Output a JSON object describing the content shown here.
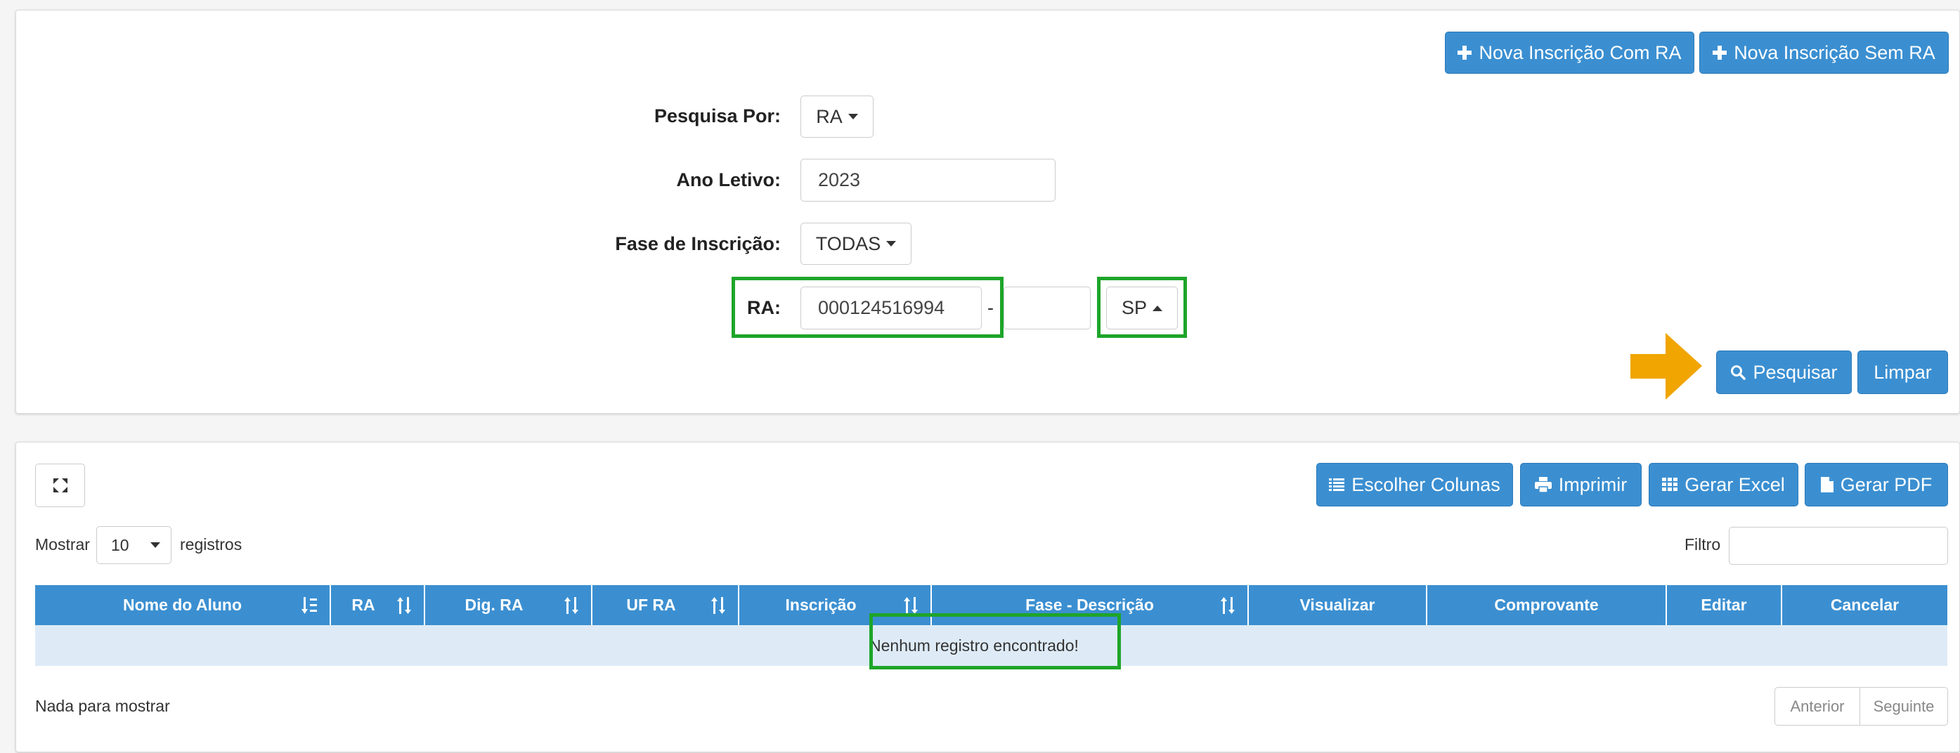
{
  "header_buttons": {
    "new_with_ra": "Nova Inscrição Com RA",
    "new_without_ra": "Nova Inscrição Sem RA"
  },
  "search_form": {
    "pesquisa_por": {
      "label": "Pesquisa Por:",
      "value": "RA"
    },
    "ano_letivo": {
      "label": "Ano Letivo:",
      "value": "2023"
    },
    "fase_inscricao": {
      "label": "Fase de Inscrição:",
      "value": "TODAS"
    },
    "ra": {
      "label": "RA:",
      "value": "000124516994",
      "separator": "-",
      "digit_value": "",
      "uf_value": "SP"
    },
    "search_button": "Pesquisar",
    "clear_button": "Limpar"
  },
  "results": {
    "toolbar": {
      "choose_columns": "Escolher Colunas",
      "print": "Imprimir",
      "excel": "Gerar Excel",
      "pdf": "Gerar PDF"
    },
    "show_prefix": "Mostrar",
    "page_size": "10",
    "show_suffix": "registros",
    "filter_label": "Filtro",
    "filter_value": "",
    "columns": [
      "Nome do Aluno",
      "RA",
      "Dig. RA",
      "UF RA",
      "Inscrição",
      "Fase - Descrição",
      "Visualizar",
      "Comprovante",
      "Editar",
      "Cancelar"
    ],
    "empty_message": "Nenhum registro encontrado!",
    "info": "Nada para mostrar",
    "pagination": {
      "previous": "Anterior",
      "next": "Seguinte"
    }
  },
  "colors": {
    "primary": "#3b8fd1",
    "highlight": "#1ea52a",
    "arrow": "#f0a500",
    "empty_row": "#deebf7"
  }
}
